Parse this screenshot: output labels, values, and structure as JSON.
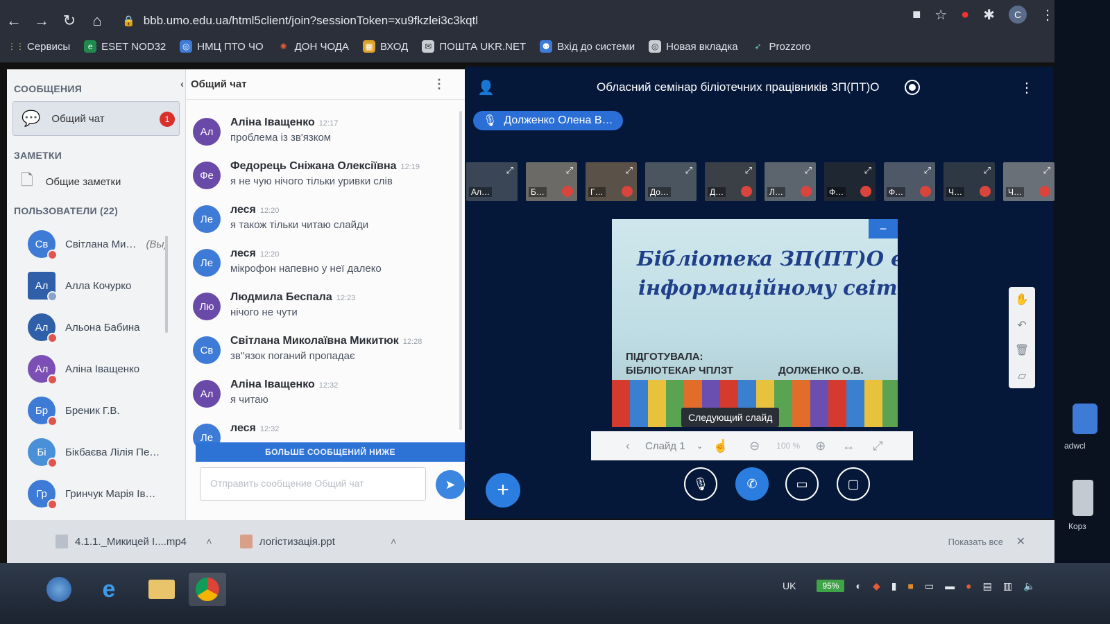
{
  "browser": {
    "url": "bbb.umo.edu.ua/html5client/join?sessionToken=xu9fkzlei3c3kqtl",
    "bookmarks": [
      "Сервисы",
      "ESET NOD32",
      "НМЦ ПТО ЧО",
      "ДОН ЧОДА",
      "ВХОД",
      "ПОШТА UKR.NET",
      "Вхід до системи",
      "Новая вкладка",
      "Prozzoro"
    ],
    "profile_initial": "C"
  },
  "sidebar": {
    "messages_header": "СООБЩЕНИЯ",
    "public_chat_label": "Общий чат",
    "public_chat_badge": "1",
    "notes_header": "ЗАМЕТКИ",
    "shared_notes_label": "Общие заметки",
    "users_header": "ПОЛЬЗОВАТЕЛИ (22)",
    "users": [
      {
        "initials": "Св",
        "name": "Світлана Ми…",
        "suffix": "(Вы)",
        "color": "#3d7bd6"
      },
      {
        "initials": "Ал",
        "name": "Алла Кочурко",
        "color": "#2f5fa8"
      },
      {
        "initials": "Ал",
        "name": "Альона Бабина",
        "color": "#2f5fa8"
      },
      {
        "initials": "Ал",
        "name": "Аліна Іващенко",
        "color": "#7b4fb3"
      },
      {
        "initials": "Бр",
        "name": "Бреник Г.В.",
        "color": "#3d7bd6"
      },
      {
        "initials": "Бі",
        "name": "Бікбаєва Лілія Пе…",
        "color": "#4a90d9"
      },
      {
        "initials": "Гр",
        "name": "Гринчук Марія Ів…",
        "color": "#3d7bd6"
      }
    ]
  },
  "chat": {
    "header": "Общий чат",
    "messages": [
      {
        "initials": "Ал",
        "name": "Аліна Іващенко",
        "time": "12:17",
        "text": "проблема із зв'язком",
        "color": "#6a4aa8"
      },
      {
        "initials": "Фе",
        "name": "Федорець Сніжана Олексіївна",
        "time": "12:19",
        "text": "я не чую нічого тільки уривки слів",
        "color": "#6a4aa8"
      },
      {
        "initials": "Ле",
        "name": "леся",
        "time": "12:20",
        "text": "я також тільки читаю слайди",
        "color": "#3d7bd6"
      },
      {
        "initials": "Ле",
        "name": "леся",
        "time": "12:20",
        "text": "мікрофон напевно у неї далеко",
        "color": "#3d7bd6"
      },
      {
        "initials": "Лю",
        "name": "Людмила Беспала",
        "time": "12:23",
        "text": "нічого не чути",
        "color": "#6a4aa8"
      },
      {
        "initials": "Св",
        "name": "Світлана Миколаївна Микитюк",
        "time": "12:28",
        "text": "зв''язок поганий пропадає",
        "color": "#3d7bd6"
      },
      {
        "initials": "Ал",
        "name": "Аліна Іващенко",
        "time": "12:32",
        "text": "я читаю",
        "color": "#6a4aa8"
      },
      {
        "initials": "Ле",
        "name": "леся",
        "time": "12:32",
        "text": "",
        "color": "#3d7bd6"
      }
    ],
    "more_messages_label": "БОЛЬШЕ СООБЩЕНИЙ НИЖЕ",
    "input_placeholder": "Отправить сообщение Общий чат"
  },
  "meeting": {
    "title": "Обласний семінар біліотечних працівників ЗП(ПТ)О",
    "talking_indicator": "Долженко Олена В…",
    "thumbnails": [
      "Ал…",
      "Б…",
      "Г…",
      "До…",
      "Д…",
      "Л…",
      "Ф…",
      "Ф…",
      "Ч…",
      "Ч…"
    ],
    "slide": {
      "title_line1": "Бібліотека ЗП(ПТ)О в",
      "title_line2": "інформаційному світі",
      "prepared_label": "ПІДГОТУВАЛА:",
      "prepared_by": "БІБЛІОТЕКАР ЧПЛЗТ",
      "author": "ДОЛЖЕНКО О.В."
    },
    "tooltip": "Следующий слайд",
    "slide_selector": "Слайд 1",
    "zoom": "100 %"
  },
  "downloads": {
    "items": [
      "4.1.1._Микицей І....mp4",
      "логістизація.ppt"
    ],
    "show_all": "Показать все"
  },
  "taskbar": {
    "language": "UK",
    "battery": "95%"
  },
  "desktop": {
    "icon1_label": "adwcl",
    "icon2_label": "Корз"
  }
}
